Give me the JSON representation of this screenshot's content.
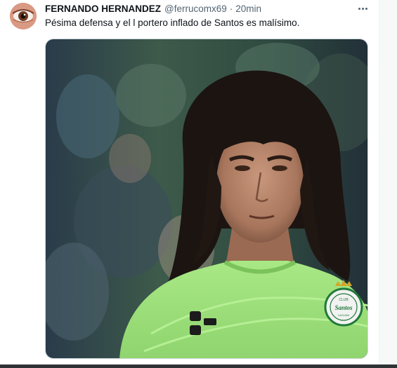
{
  "tweet": {
    "author_name": "FERNANDO HERNANDEZ",
    "handle": "@ferrucomx69",
    "separator": "·",
    "time": "20min",
    "text": "Pésima defensa y el l portero inflado de Santos es malísimo.",
    "more_icon": "ellipsis-icon"
  },
  "media": {
    "type": "photo",
    "jersey_badge_text": "Santos",
    "jersey_badge_top": "CLUB",
    "jersey_badge_bottom": "LAGUNA"
  },
  "colors": {
    "name": "#0f1419",
    "secondary_text": "#536471",
    "media_border": "#cfd9de",
    "jersey": "#9ee07a"
  }
}
